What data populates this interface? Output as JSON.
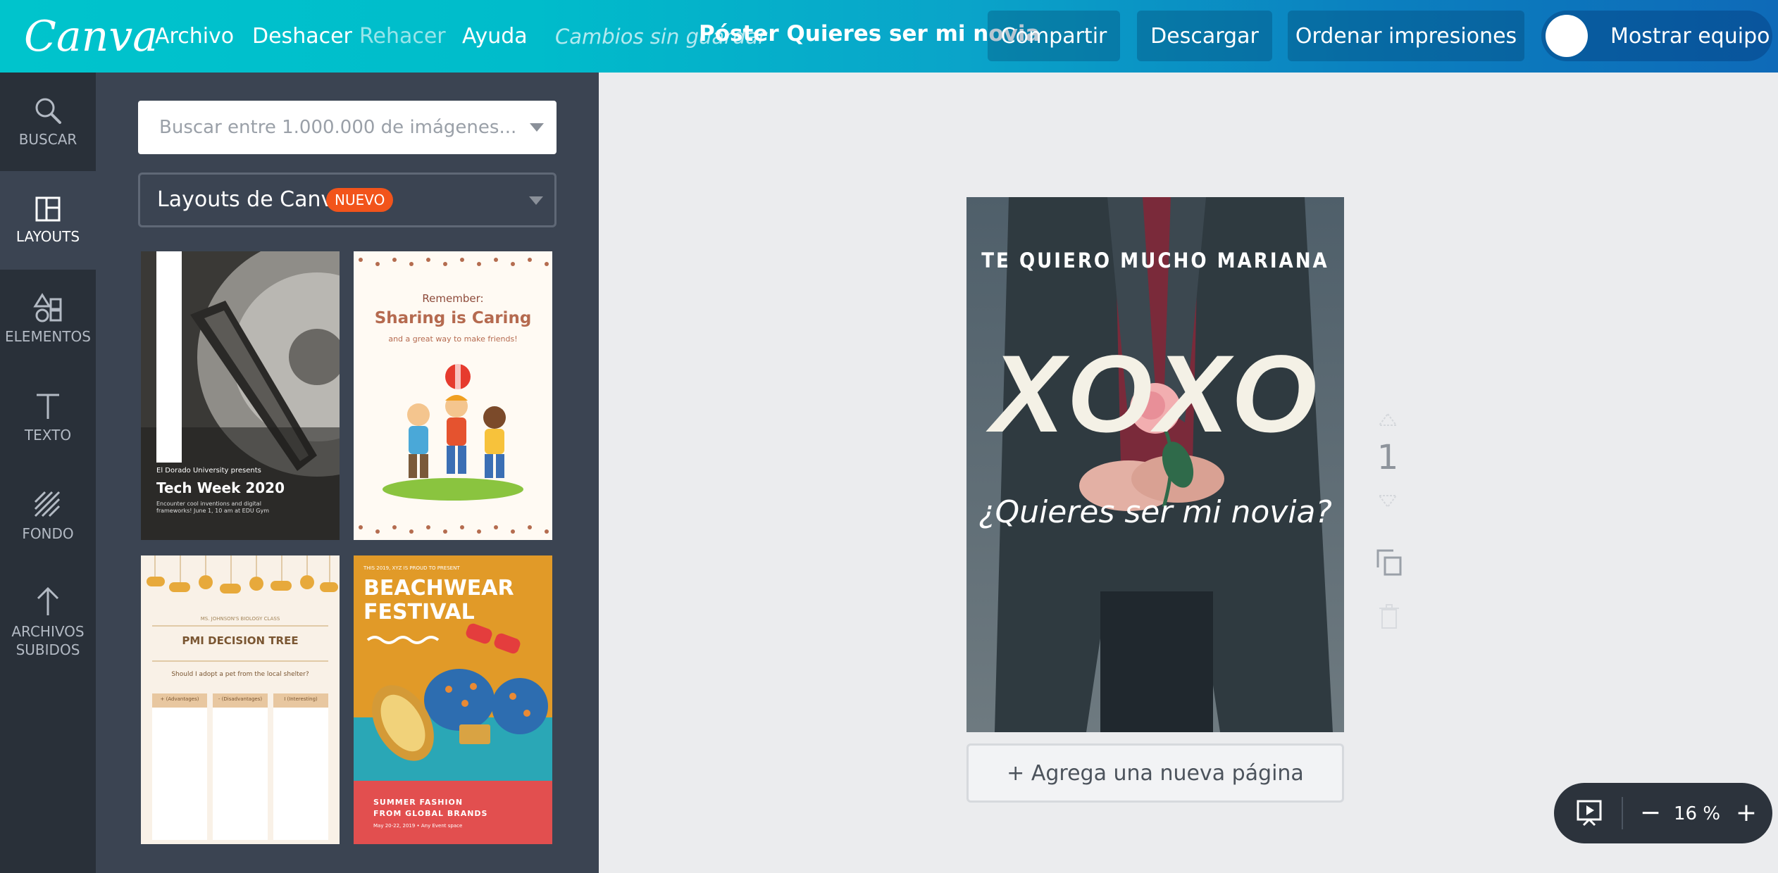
{
  "topbar": {
    "logo": "Canva",
    "menu": [
      "Archivo",
      "Deshacer",
      "Rehacer",
      "Ayuda"
    ],
    "unsaved_status": "Cambios sin guardar",
    "document_title": "Póster Quieres ser mi novia",
    "share_label": "Compartir",
    "download_label": "Descargar",
    "print_label": "Ordenar impresiones",
    "team_label": "Mostrar equipo"
  },
  "rail": {
    "items": [
      {
        "label": "BUSCAR",
        "icon": "search-icon"
      },
      {
        "label": "LAYOUTS",
        "icon": "layouts-icon"
      },
      {
        "label": "ELEMENTOS",
        "icon": "elements-icon"
      },
      {
        "label": "TEXTO",
        "icon": "text-icon"
      },
      {
        "label": "FONDO",
        "icon": "background-icon"
      },
      {
        "label": "ARCHIVOS SUBIDOS",
        "icon": "upload-icon"
      }
    ]
  },
  "panel": {
    "search_placeholder": "Buscar entre 1.000.000 de imágenes...",
    "layouts_label": "Layouts de Canva",
    "new_badge": "NUEVO",
    "templates": {
      "tech": {
        "small": "El Dorado University presents",
        "title": "Tech Week 2020",
        "desc": "Encounter cool inventions and digital frameworks! June 1, 10 am at EDU Gym"
      },
      "sharing": {
        "kicker": "Remember:",
        "title": "Sharing is Caring",
        "sub": "and a great way to make friends!"
      },
      "pmi": {
        "class": "MS. JOHNSON'S BIOLOGY CLASS",
        "title": "PMI DECISION TREE",
        "question": "Should I adopt a pet from the local shelter?",
        "col1": "+ (Advantages)",
        "col2": "- (Disadvantages)",
        "col3": "I (Interesting)"
      },
      "beach": {
        "small": "THIS 2019, XYZ IS PROUD TO PRESENT",
        "title1": "BEACHWEAR",
        "title2": "FESTIVAL",
        "foot1": "SUMMER FASHION",
        "foot2": "FROM GLOBAL BRANDS",
        "date": "May 20-22, 2019 • Any Event space"
      }
    }
  },
  "canvas": {
    "poster": {
      "line1": "TE QUIERO MUCHO MARIANA",
      "main": "XOXO",
      "question": "¿Quieres ser mi novia?"
    },
    "page_number": "1",
    "add_page_label": "+ Agrega una nueva página"
  },
  "zoom": {
    "minus": "−",
    "value": "16 %",
    "plus": "+"
  },
  "colors": {
    "accent": "#00c4cc",
    "badge": "#f2541b",
    "rail": "#293039",
    "panel": "#3b4452"
  }
}
